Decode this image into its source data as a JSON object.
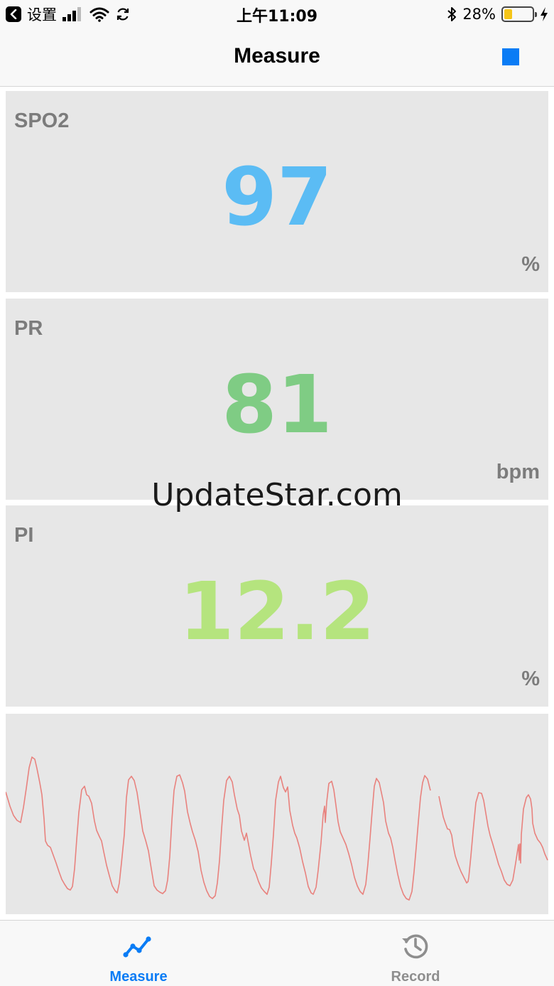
{
  "status_bar": {
    "carrier": "设置",
    "time": "上午11:09",
    "battery_percent": "28%",
    "battery_level": 0.28
  },
  "nav": {
    "title": "Measure",
    "stop_icon": "stop-icon"
  },
  "cards": [
    {
      "label": "SPO2",
      "value": "97",
      "unit": "%",
      "color": "#5bbcf4"
    },
    {
      "label": "PR",
      "value": "81",
      "unit": "bpm",
      "color": "#7fcc84"
    },
    {
      "label": "PI",
      "value": "12.2",
      "unit": "%",
      "color": "#b5e47e"
    }
  ],
  "watermark": "UpdateStar.com",
  "waveform": {
    "color": "#e8827e"
  },
  "tabs": [
    {
      "label": "Measure",
      "icon": "waveform-icon",
      "active": true,
      "color": "#0a7cf5"
    },
    {
      "label": "Record",
      "icon": "history-icon",
      "active": false,
      "color": "#8e8e8e"
    }
  ]
}
